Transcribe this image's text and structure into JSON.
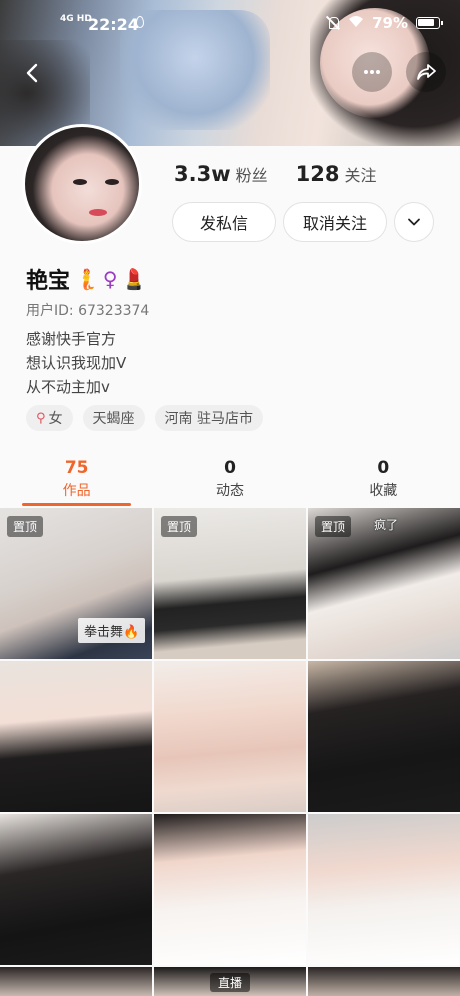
{
  "status_bar": {
    "signal": "4G HD",
    "time": "22:24",
    "battery": "79%"
  },
  "profile": {
    "followers_count": "3.3w",
    "followers_label": "粉丝",
    "following_count": "128",
    "following_label": "关注",
    "message_button": "发私信",
    "unfollow_button": "取消关注",
    "name": "艳宝",
    "name_emojis": [
      "🧜",
      "♀",
      "💄"
    ],
    "user_id": "用户ID: 67323374",
    "bio_lines": [
      "感谢快手官方",
      "想认识我现加V",
      "从不动主加v"
    ],
    "tags": [
      {
        "icon": "female-icon",
        "label": "女"
      },
      {
        "label": "天蝎座"
      },
      {
        "label": "河南 驻马店市"
      }
    ]
  },
  "tabs": [
    {
      "count": "75",
      "label": "作品",
      "active": true
    },
    {
      "count": "0",
      "label": "动态",
      "active": false
    },
    {
      "count": "0",
      "label": "收藏",
      "active": false
    }
  ],
  "grid": {
    "pinned_label": "置顶",
    "item1_caption": "拳击舞🔥",
    "item3_caption": "疯了",
    "item11_label": "直播"
  },
  "colors": {
    "accent": "#f0652b"
  }
}
